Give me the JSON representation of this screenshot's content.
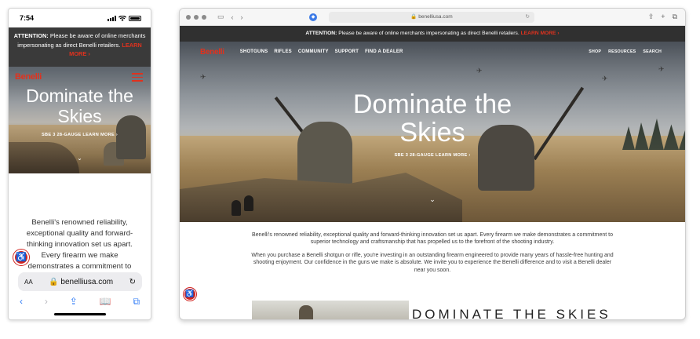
{
  "phone": {
    "time": "7:54",
    "alert": {
      "label": "ATTENTION:",
      "text": "Please be aware of online merchants impersonating as direct Benelli retailers.",
      "link": "LEARN MORE ›"
    },
    "logo": "Benelli",
    "hero_title": "Dominate the Skies",
    "hero_cta": "SBE 3 28-GAUGE LEARN MORE ›",
    "body": "Benelli's renowned reliability, exceptional quality and forward-thinking innovation set us apart. Every firearm we make demonstrates a commitment to superior technology",
    "url_aa": "AA",
    "url": "benelliusa.com"
  },
  "desktop": {
    "url": "benelliusa.com",
    "alert": {
      "label": "ATTENTION:",
      "text": "Please be aware of online merchants impersonating as direct Benelli retailers.",
      "link": "LEARN MORE ›"
    },
    "logo": "Benelli",
    "nav": [
      "SHOTGUNS",
      "RIFLES",
      "COMMUNITY",
      "SUPPORT",
      "FIND A DEALER"
    ],
    "nav_right": [
      "SHOP",
      "RESOURCES",
      "SEARCH"
    ],
    "hero_title": "Dominate the Skies",
    "hero_cta": "SBE 3 28-GAUGE LEARN MORE ›",
    "para1": "Benelli's renowned reliability, exceptional quality and forward-thinking innovation set us apart. Every firearm we make demonstrates a commitment to superior technology and craftsmanship that has propelled us to the forefront of the shooting industry.",
    "para2": "When you purchase a Benelli shotgun or rifle, you're investing in an outstanding firearm engineered to provide many years of hassle-free hunting and shooting enjoyment. Our confidence in the guns we make is absolute. We invite you to experience the Benelli difference and to visit a Benelli dealer near you soon.",
    "promo_title": "DOMINATE THE SKIES"
  },
  "colors": {
    "brand_red": "#e0321e",
    "alert_bg": "#303030",
    "ios_blue": "#2f7bf6"
  },
  "icons": [
    "wifi-icon",
    "battery-icon",
    "menu-icon",
    "chevron-down-icon",
    "accessibility-icon",
    "reload-icon",
    "back-icon",
    "forward-icon",
    "share-icon",
    "bookmarks-icon",
    "tabs-icon",
    "sidebar-icon",
    "plus-icon"
  ]
}
